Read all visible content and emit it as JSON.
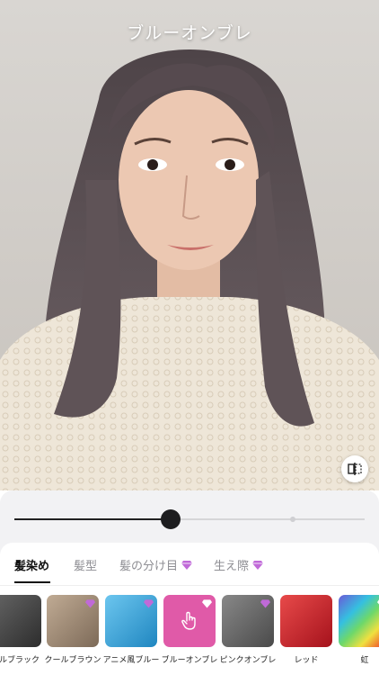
{
  "header": {
    "title": "ブルーオンブレ"
  },
  "photo": {
    "compare_icon": "compare-split-icon"
  },
  "slider": {
    "value": 0.44
  },
  "tabs": [
    {
      "label": "髪染め",
      "active": true,
      "premium": false
    },
    {
      "label": "髪型",
      "active": false,
      "premium": false
    },
    {
      "label": "髪の分け目",
      "active": false,
      "premium": true
    },
    {
      "label": "生え際",
      "active": false,
      "premium": true
    }
  ],
  "swatches": [
    {
      "label": "ールブラック",
      "color": "#444444"
    },
    {
      "label": "クールブラウン",
      "color": "#9a8672"
    },
    {
      "label": "アニメ風ブルー",
      "color": "#2fa3d6"
    },
    {
      "label": "ブルーオンブレ",
      "color": "#e05aa8",
      "selected": true
    },
    {
      "label": "ピンクオンブレ",
      "color": "#6a6a6a"
    },
    {
      "label": "レッド",
      "color": "#d0202a"
    },
    {
      "label": "虹",
      "color": "#8a6ad0"
    }
  ],
  "colors": {
    "accent": "#111111",
    "premium": "#c06ad8"
  }
}
